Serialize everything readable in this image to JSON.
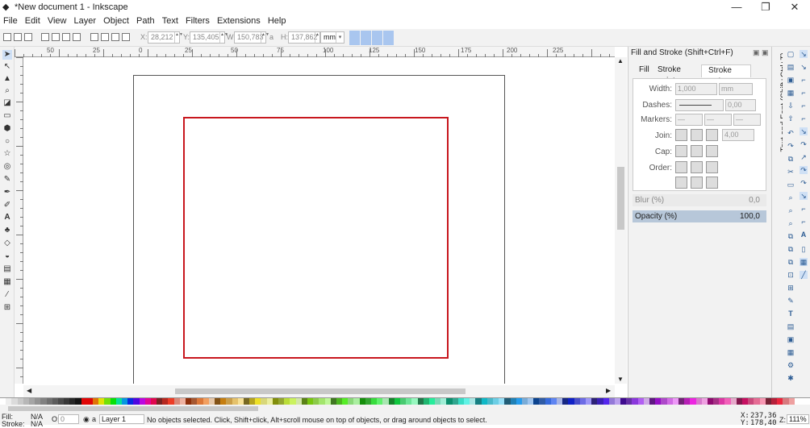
{
  "window": {
    "title": "*New document 1 - Inkscape",
    "min": "—",
    "max": "❐",
    "close": "✕"
  },
  "menu": [
    "File",
    "Edit",
    "View",
    "Layer",
    "Object",
    "Path",
    "Text",
    "Filters",
    "Extensions",
    "Help"
  ],
  "toolbar": {
    "x_label": "X:",
    "x": "28,212",
    "y_label": "Y:",
    "y": "135,405",
    "w_label": "W:",
    "w": "150,783",
    "lock": "a",
    "h_label": "H:",
    "h": "137,862",
    "unit": "mm"
  },
  "ruler_ticks": [
    "50",
    "25",
    "0",
    "25",
    "50",
    "75",
    "100",
    "125",
    "150",
    "175",
    "200",
    "225"
  ],
  "panel": {
    "title": "Fill and Stroke (Shift+Ctrl+F)",
    "tabs": {
      "fill": "Fill",
      "stroke_paint": "Stroke paint",
      "stroke_style": "Stroke style"
    },
    "width_label": "Width:",
    "width_value": "1,000",
    "width_unit": "mm",
    "dashes_label": "Dashes:",
    "dashes_value": "0,00",
    "markers_label": "Markers:",
    "markers_values": [
      "—",
      "—",
      "—"
    ],
    "join_label": "Join:",
    "join_value": "4,00",
    "cap_label": "Cap:",
    "order_label": "Order:",
    "blur_label": "Blur (%)",
    "blur_value": "0,0",
    "opacity_label": "Opacity (%)",
    "opacity_value": "100,0"
  },
  "side_tab": "Text and Font (Shift+Ctrl+T)",
  "status": {
    "fill_label": "Fill:",
    "fill_value": "N/A",
    "stroke_label": "Stroke:",
    "stroke_value": "N/A",
    "o_label": "O:",
    "o_value": "0",
    "layer": "Layer 1",
    "message": "No objects selected. Click, Shift+click, Alt+scroll mouse on top of objects, or drag around objects to select.",
    "x_label": "X:",
    "x_value": "237,36",
    "y_label": "Y:",
    "y_value": "178,40",
    "z_label": "Z:",
    "zoom": "111%"
  },
  "colors": {
    "stroke": "#c8171e",
    "accent": "#a9c6ef",
    "opacity_bar": "#b7c7d9"
  }
}
